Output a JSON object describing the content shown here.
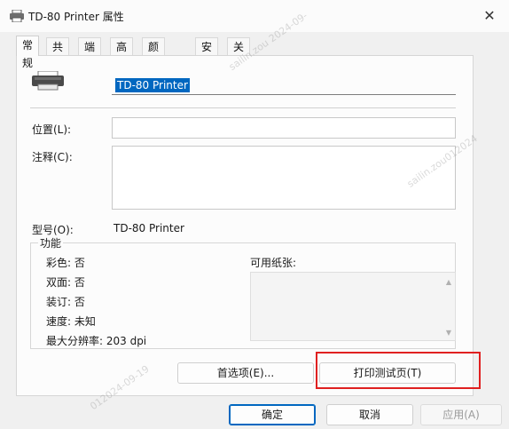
{
  "window": {
    "title": "TD-80 Printer 属性",
    "close_glyph": "✕"
  },
  "tabs": [
    {
      "label": "常规",
      "active": true
    },
    {
      "label": "共享"
    },
    {
      "label": "端口"
    },
    {
      "label": "高级"
    },
    {
      "label": "颜色管理"
    },
    {
      "label": "安全"
    },
    {
      "label": "关于"
    }
  ],
  "general": {
    "printer_name": "TD-80 Printer",
    "location_label": "位置(L):",
    "location_value": "",
    "comment_label": "注释(C):",
    "comment_value": "",
    "model_label": "型号(O):",
    "model_value": "TD-80 Printer"
  },
  "features": {
    "legend": "功能",
    "color": "彩色: 否",
    "duplex": "双面: 否",
    "staple": "装订: 否",
    "speed": "速度: 未知",
    "max_resolution": "最大分辨率: 203 dpi",
    "paper_label": "可用纸张:"
  },
  "buttons": {
    "preferences": "首选项(E)...",
    "print_test": "打印测试页(T)",
    "ok": "确定",
    "cancel": "取消",
    "apply": "应用(A)"
  },
  "watermark": {
    "top": "sailin.zou 2024-09-",
    "right": "sailin.zou012024",
    "bottom": "012024-09-19"
  },
  "colors": {
    "accent": "#0067c0",
    "highlight": "#e02020"
  }
}
